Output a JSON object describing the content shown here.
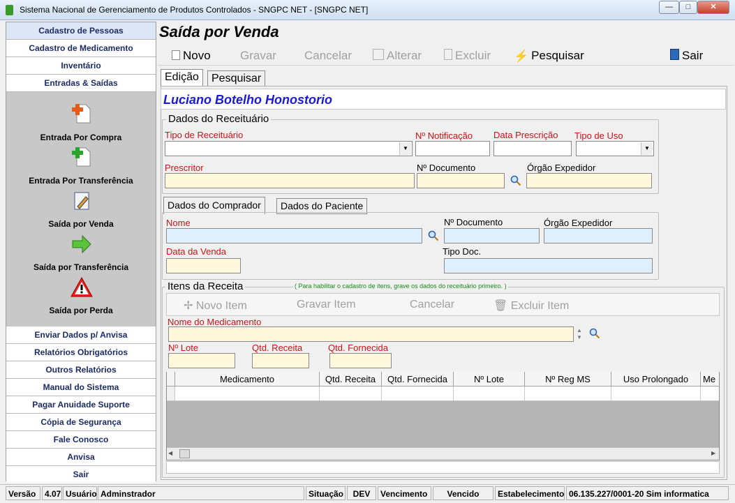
{
  "window": {
    "title": "Sistema Nacional de Gerenciamento de Produtos Controlados - SNGPC NET - [SNGPC NET]"
  },
  "sidebar": {
    "top_items": [
      "Cadastro de Pessoas",
      "Cadastro de Medicamento",
      "Inventário",
      "Entradas & Saídas"
    ],
    "panel_items": [
      "Entrada Por Compra",
      "Entrada Por Transferência",
      "Saída por Venda",
      "Saída por Transferência",
      "Saída por Perda"
    ],
    "bottom_items": [
      "Enviar Dados p/ Anvisa",
      "Relatórios Obrigatórios",
      "Outros Relatórios",
      "Manual do Sistema",
      "Pagar Anuidade Suporte",
      "Cópia de Segurança",
      "Fale Conosco",
      "Anvisa",
      "Sair"
    ]
  },
  "page": {
    "title": "Saída por Venda"
  },
  "toolbar": {
    "novo": "Novo",
    "gravar": "Gravar",
    "cancelar": "Cancelar",
    "alterar": "Alterar",
    "excluir": "Excluir",
    "pesquisar": "Pesquisar",
    "sair": "Sair"
  },
  "tabs": {
    "edicao": "Edição",
    "pesquisar": "Pesquisar"
  },
  "patient": {
    "name": "Luciano Botelho Honostorio"
  },
  "receituario": {
    "title": "Dados do Receituário",
    "tipo_receituario": "Tipo de Receituário",
    "n_notificacao": "Nº Notificação",
    "data_prescricao": "Data Prescrição",
    "tipo_uso": "Tipo de Uso",
    "prescritor": "Prescritor",
    "n_documento": "Nº Documento",
    "orgao_expedidor": "Órgão Expedidor"
  },
  "comprador_tabs": {
    "comprador": "Dados do Comprador",
    "paciente": "Dados do Paciente"
  },
  "comprador": {
    "nome": "Nome",
    "n_documento": "Nº Documento",
    "orgao_expedidor": "Órgão Expedidor",
    "data_venda": "Data da Venda",
    "tipo_doc": "Tipo Doc."
  },
  "itens": {
    "title": "Itens da Receita",
    "hint": "( Para habilitar o cadastro de itens, grave os dados do receituário primeiro. )",
    "novo_item": "Novo Item",
    "gravar_item": "Gravar Item",
    "cancelar": "Cancelar",
    "excluir_item": "Excluir Item",
    "nome_medicamento": "Nome do Medicamento",
    "n_lote": "Nº Lote",
    "qtd_receita": "Qtd. Receita",
    "qtd_fornecida": "Qtd. Fornecida",
    "columns": [
      "Medicamento",
      "Qtd. Receita",
      "Qtd. Fornecida",
      "Nº Lote",
      "Nº Reg MS",
      "Uso Prolongado",
      "Me"
    ]
  },
  "statusbar": {
    "versao_label": "Versão",
    "versao": "4.07",
    "usuario_label": "Usuário",
    "usuario": "Adminstrador",
    "situacao_label": "Situação",
    "situacao": "DEV",
    "vencimento_label": "Vencimento",
    "vencimento": "Vencido",
    "estabelecimento_label": "Estabelecimento",
    "estabelecimento": "06.135.227/0001-20 Sim informatica"
  }
}
